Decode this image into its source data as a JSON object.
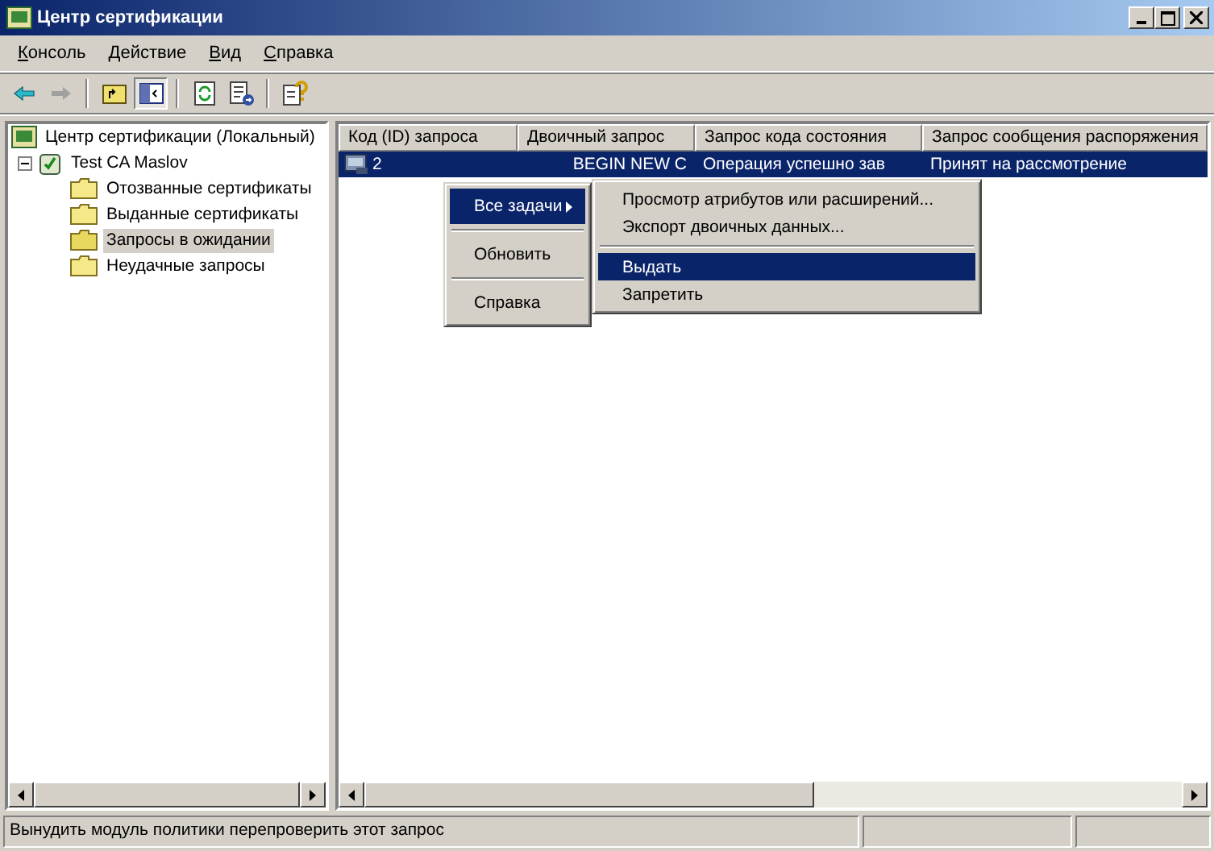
{
  "window": {
    "title": "Центр сертификации"
  },
  "menu": [
    {
      "label": "Консоль"
    },
    {
      "label": "Действие"
    },
    {
      "label": "Вид"
    },
    {
      "label": "Справка"
    }
  ],
  "tree": {
    "label": "Центр сертификации (Локальный)",
    "children": [
      {
        "label": "Test CA Maslov",
        "expanded": true,
        "children": [
          {
            "label": "Отозванные сертификаты",
            "selected": false
          },
          {
            "label": "Выданные сертификаты",
            "selected": false
          },
          {
            "label": "Запросы в ожидании",
            "selected": true
          },
          {
            "label": "Неудачные запросы",
            "selected": false
          }
        ]
      }
    ]
  },
  "table": {
    "columns": [
      "Код (ID) запроса",
      "Двоичный запрос",
      "Запрос кода состояния",
      "Запрос сообщения распоряжения"
    ],
    "rows": [
      {
        "selected": true,
        "cells": [
          "2",
          "BEGIN NEW C",
          "Операция успешно зав",
          "Принят на рассмотрение"
        ]
      }
    ]
  },
  "context_menu": [
    {
      "kind": "item",
      "label": "Все задачи",
      "submenu": true,
      "selected": true
    },
    {
      "kind": "separator"
    },
    {
      "kind": "item",
      "label": "Обновить",
      "submenu": false,
      "selected": false
    },
    {
      "kind": "separator"
    },
    {
      "kind": "item",
      "label": "Справка",
      "submenu": false,
      "selected": false
    }
  ],
  "submenu": [
    {
      "kind": "item",
      "label": "Просмотр атрибутов или расширений...",
      "selected": false
    },
    {
      "kind": "item",
      "label": "Экспорт двоичных данных...",
      "selected": false
    },
    {
      "kind": "separator"
    },
    {
      "kind": "item",
      "label": "Выдать",
      "selected": true
    },
    {
      "kind": "item",
      "label": "Запретить",
      "selected": false
    }
  ],
  "status_bar": {
    "text": "Вынудить модуль политики перепроверить этот запрос"
  }
}
